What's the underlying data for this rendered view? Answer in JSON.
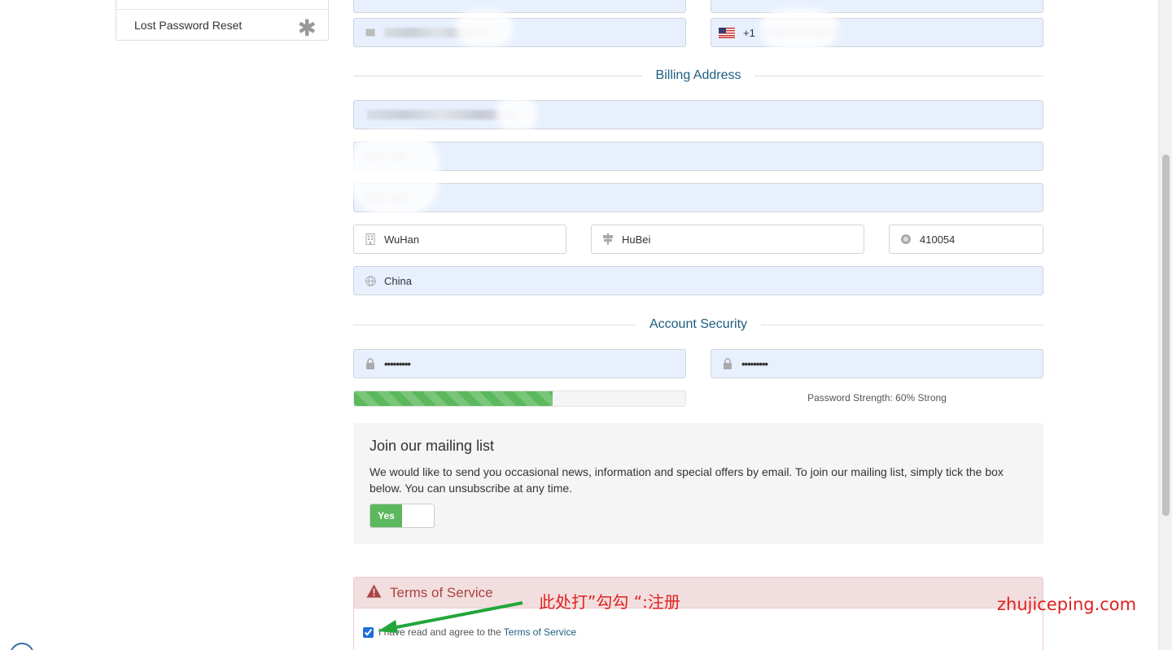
{
  "sidebar": {
    "items": [
      {
        "label": "Lost Password Reset"
      }
    ]
  },
  "contact": {
    "phone_prefix": "+1"
  },
  "billing": {
    "heading": "Billing Address",
    "city": "WuHan",
    "state": "HuBei",
    "postcode": "410054",
    "country": "China"
  },
  "security": {
    "heading": "Account Security",
    "password_mask": "•••••••••",
    "confirm_mask": "•••••••••",
    "strength_label": "Password Strength: 60% Strong",
    "strength_value": 0.6
  },
  "mailing": {
    "title": "Join our mailing list",
    "body": "We would like to send you occasional news, information and special offers by email. To join our mailing list, simply tick the box below. You can unsubscribe at any time.",
    "toggle_label": "Yes"
  },
  "tos": {
    "title": "Terms of Service",
    "agree_text": "I have read and agree to the",
    "link_text": "Terms of Service",
    "checked": true
  },
  "annotation": {
    "text": "此处打”勾勾 “:注册",
    "watermark": "zhujiceping.com",
    "color": "#e02020"
  },
  "colors": {
    "accent": "#1c5e80",
    "success": "#5cb85c",
    "danger": "#a94442",
    "autofill": "#e8f0fe"
  }
}
